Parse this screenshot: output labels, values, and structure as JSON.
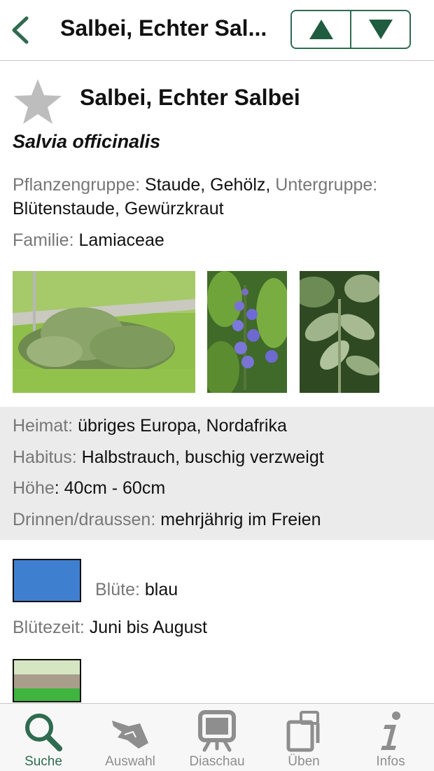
{
  "nav": {
    "title": "Salbei, Echter Sal..."
  },
  "plant": {
    "name": "Salbei, Echter Salbei",
    "scientific": "Salvia officinalis",
    "pflanzengruppe_label": "Pflanzengruppe:",
    "pflanzengruppe_value": "Staude, Gehölz,",
    "untergruppe_label": "Untergruppe:",
    "untergruppe_value": "Blütenstaude, Gewürzkraut",
    "familie_label": "Familie:",
    "familie_value": "Lamiaceae",
    "heimat_label": "Heimat:",
    "heimat_value": "übriges Europa, Nordafrika",
    "habitus_label": "Habitus:",
    "habitus_value": "Halbstrauch, buschig verzweigt",
    "hoehe_label": "Höhe",
    "hoehe_value": ": 40cm - 60cm",
    "drinnen_label": "Drinnen/draussen:",
    "drinnen_value": "mehrjährig im Freien",
    "bluete_label": "Blüte:",
    "bluete_value": "blau",
    "bluete_color": "#3f7fcf",
    "bluetezeit_label": "Blütezeit:",
    "bluetezeit_value": "Juni bis August"
  },
  "tabs": [
    {
      "label": "Suche",
      "icon": "search-icon",
      "active": true
    },
    {
      "label": "Auswahl",
      "icon": "hand-icon",
      "active": false
    },
    {
      "label": "Diaschau",
      "icon": "slideshow-icon",
      "active": false
    },
    {
      "label": "Üben",
      "icon": "cards-icon",
      "active": false
    },
    {
      "label": "Infos",
      "icon": "info-icon",
      "active": false
    }
  ],
  "colors": {
    "accent": "#2f6b4f",
    "inactive": "#8e8e8e",
    "panel": "#ebebeb"
  }
}
